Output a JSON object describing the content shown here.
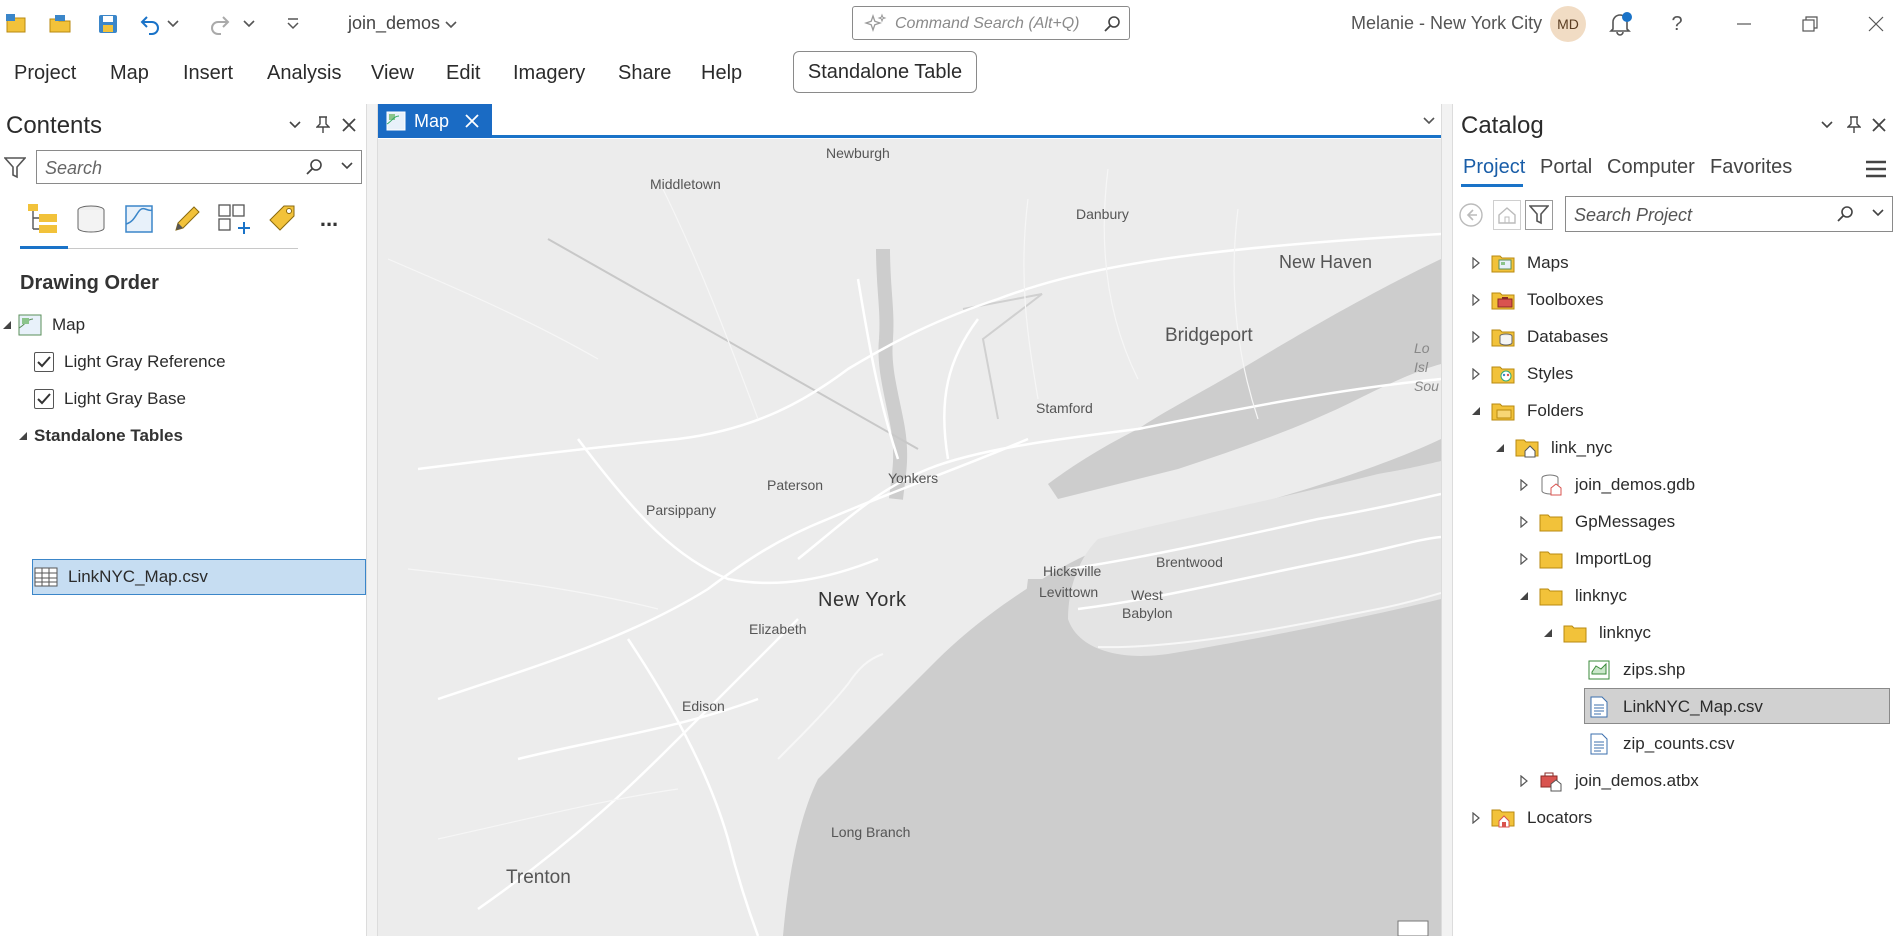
{
  "title_bar": {
    "project_name": "join_demos",
    "command_search_placeholder": "Command Search (Alt+Q)",
    "user_label": "Melanie - New York City",
    "avatar_initials": "MD",
    "help_label": "?"
  },
  "ribbon": {
    "tabs": [
      "Project",
      "Map",
      "Insert",
      "Analysis",
      "View",
      "Edit",
      "Imagery",
      "Share",
      "Help"
    ],
    "context_tab": "Standalone Table"
  },
  "contents": {
    "title": "Contents",
    "search_placeholder": "Search",
    "more_label": "...",
    "section_title": "Drawing Order",
    "map_label": "Map",
    "layers": [
      {
        "label": "Light Gray Reference",
        "checked": true
      },
      {
        "label": "Light Gray Base",
        "checked": true
      }
    ],
    "standalone_tables_label": "Standalone Tables",
    "selected_table": "LinkNYC_Map.csv"
  },
  "map_view": {
    "tab_label": "Map",
    "places": {
      "newburgh": "Newburgh",
      "middletown": "Middletown",
      "danbury": "Danbury",
      "new_haven": "New Haven",
      "bridgeport": "Bridgeport",
      "stamford": "Stamford",
      "paterson": "Paterson",
      "yonkers": "Yonkers",
      "parsippany": "Parsippany",
      "hicksville": "Hicksville",
      "levittown": "Levittown",
      "brentwood": "Brentwood",
      "west_babylon": "West Babylon",
      "new_york": "New York",
      "elizabeth": "Elizabeth",
      "edison": "Edison",
      "long_branch": "Long Branch",
      "trenton": "Trenton",
      "long_island_sound": "Lo Isl Sou"
    }
  },
  "catalog": {
    "title": "Catalog",
    "tabs": [
      "Project",
      "Portal",
      "Computer",
      "Favorites"
    ],
    "search_placeholder": "Search Project",
    "tree": [
      {
        "label": "Maps"
      },
      {
        "label": "Toolboxes"
      },
      {
        "label": "Databases"
      },
      {
        "label": "Styles"
      },
      {
        "label": "Folders"
      },
      {
        "label": "link_nyc"
      },
      {
        "label": "join_demos.gdb"
      },
      {
        "label": "GpMessages"
      },
      {
        "label": "ImportLog"
      },
      {
        "label": "linknyc"
      },
      {
        "label": "linknyc"
      },
      {
        "label": "zips.shp"
      },
      {
        "label": "LinkNYC_Map.csv"
      },
      {
        "label": "zip_counts.csv"
      },
      {
        "label": "join_demos.atbx"
      },
      {
        "label": "Locators"
      }
    ]
  },
  "colors": {
    "accent": "#1a73c8",
    "map_tab": "#1a6bc4",
    "selection": "#c6ddf2",
    "catalog_selection": "#d1d1d1",
    "map_land": "#ececec",
    "map_water": "#cdcdcd",
    "folder": "#f2c23a"
  }
}
